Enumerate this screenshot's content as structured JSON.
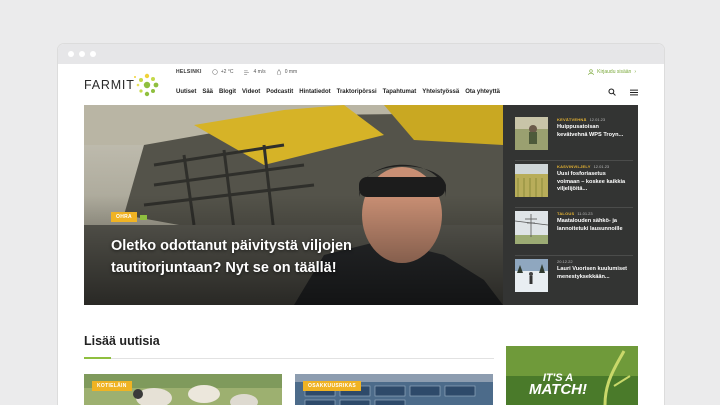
{
  "brand": {
    "name": "FARMIT",
    "accent": "#8fbf3f"
  },
  "topinfo": {
    "city": "HELSINKI",
    "temp": "+2 °C",
    "wind": "4 m/s",
    "rain": "0 mm"
  },
  "account": {
    "login_label": "Kirjaudu sisään"
  },
  "nav": {
    "items": [
      "Uutiset",
      "Sää",
      "Blogit",
      "Videot",
      "Podcastit",
      "Hintatiedot",
      "Traktoripörssi",
      "Tapahtumat",
      "Yhteistyössä",
      "Ota yhteyttä"
    ],
    "search_icon": "search-icon",
    "menu_icon": "hamburger-menu-icon"
  },
  "hero": {
    "tag": "OHRA",
    "title": "Oletko odottanut päivitystä viljojen tautitorjuntaan? Nyt se on täällä!"
  },
  "sidebar": {
    "items": [
      {
        "category": "KEVÄTVEHNÄ",
        "date": "12.01.23",
        "title": "Huippusatoisan kevätvehnä WPS Troyn..."
      },
      {
        "category": "KASVINVILJELY",
        "date": "12.01.23",
        "title": "Uusi fosforiasetus voimaan – koskee kaikkia viljelijöitä..."
      },
      {
        "category": "TALOUS",
        "date": "11.01.23",
        "title": "Maatalouden sähkö- ja lannoitetuki lausunnoille"
      },
      {
        "category": "",
        "date": "20.12.22",
        "title": "Lauri Vuorisen kuulumiset menestyksekkään..."
      }
    ]
  },
  "more": {
    "heading": "Lisää uutisia",
    "cards": [
      {
        "tag": "KOTIELÄIN"
      },
      {
        "tag": "OSAKKUUSRIKAS"
      }
    ]
  },
  "ad": {
    "line1": "IT'S A",
    "line2": "MATCH!"
  }
}
